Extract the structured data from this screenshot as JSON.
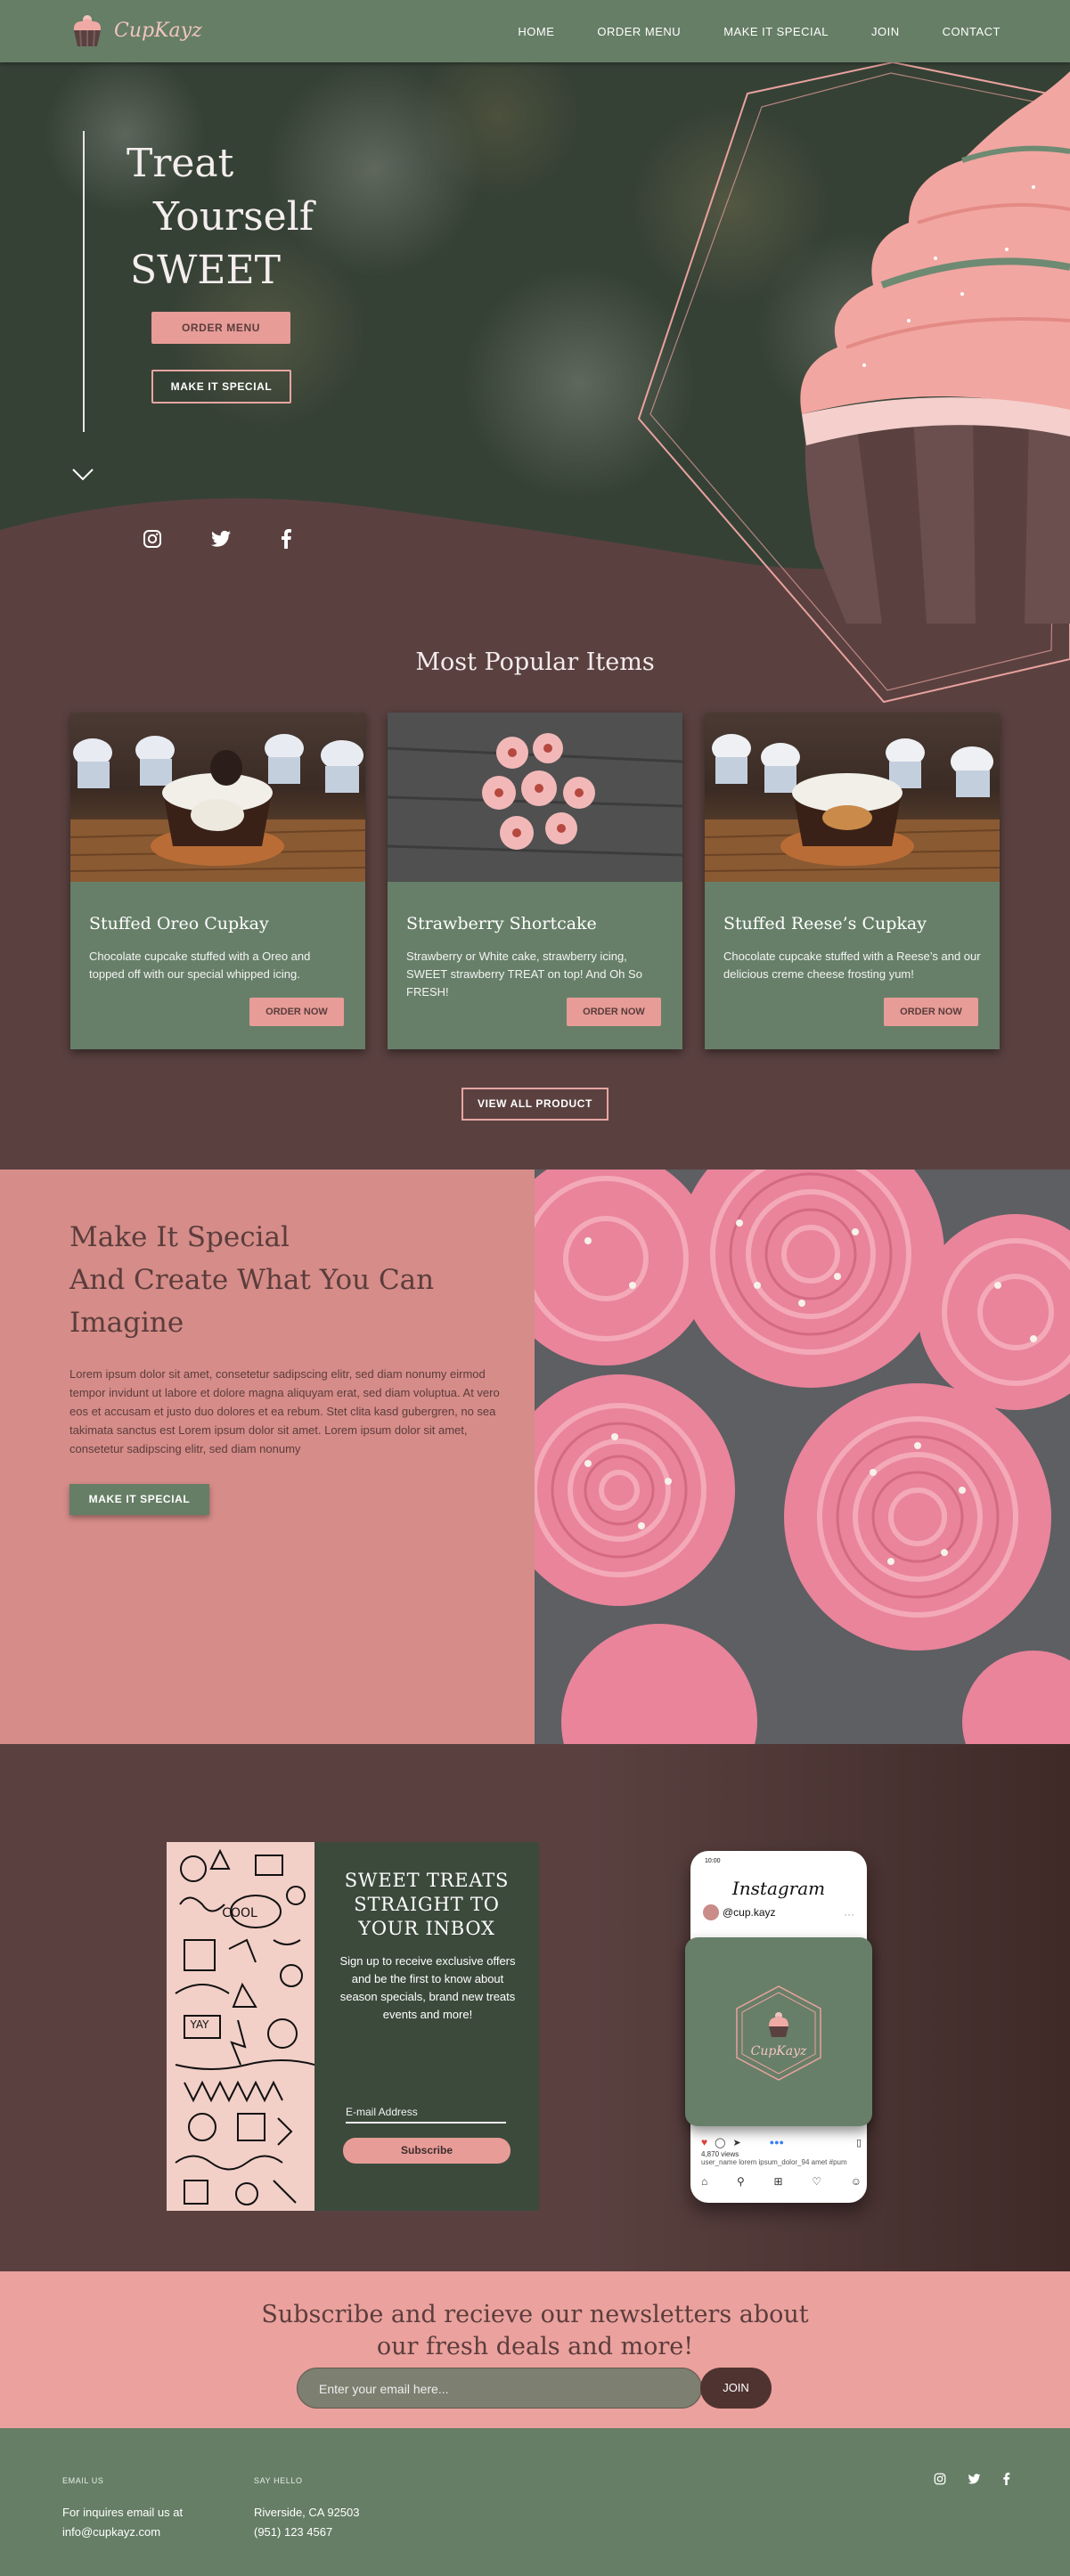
{
  "nav": {
    "logo_text": "CupKayz",
    "links": [
      "HOME",
      "ORDER MENU",
      "MAKE IT SPECIAL",
      "JOIN",
      "CONTACT"
    ]
  },
  "hero": {
    "title_lines": [
      "Treat",
      "Yourself",
      "SWEET"
    ],
    "btn_order": "ORDER MENU",
    "btn_special": "MAKE IT SPECIAL",
    "social_icons": [
      "instagram-icon",
      "twitter-icon",
      "facebook-icon"
    ]
  },
  "popular": {
    "title": "Most Popular Items",
    "items": [
      {
        "title": "Stuffed Oreo Cupkay",
        "desc": "Chocolate cupcake stuffed with a Oreo and topped off with our special whipped icing.",
        "btn": "ORDER NOW"
      },
      {
        "title": "Strawberry Shortcake",
        "desc": "Strawberry or White cake, strawberry icing, SWEET strawberry TREAT on top! And Oh So FRESH!",
        "btn": "ORDER NOW"
      },
      {
        "title": "Stuffed Reese’s Cupkay",
        "desc": "Chocolate cupcake stuffed with a Reese’s and our delicious creme cheese frosting yum!",
        "btn": "ORDER NOW"
      }
    ],
    "view_all": "VIEW ALL PRODUCT"
  },
  "special": {
    "title_lines": [
      "Make It Special",
      "And Create What You Can",
      "Imagine"
    ],
    "text": "Lorem ipsum dolor sit amet, consetetur sadipscing elitr, sed diam nonumy eirmod tempor invidunt ut labore et dolore magna aliquyam erat, sed diam voluptua. At vero eos et accusam et justo duo dolores et ea rebum. Stet clita kasd gubergren, no sea takimata sanctus est Lorem ipsum dolor sit amet. Lorem ipsum dolor sit amet, consetetur sadipscing elitr, sed diam nonumy",
    "btn": "MAKE IT SPECIAL"
  },
  "newsletter_card": {
    "heading_lines": [
      "SWEET TREATS",
      "STRAIGHT TO",
      "YOUR INBOX"
    ],
    "body": "Sign up to receive exclusive offers and be the first to know about season specials, brand new treats events and more!",
    "email_label": "E-mail Address",
    "btn": "Subscribe",
    "doodle_words": [
      "COOL",
      "YAY"
    ]
  },
  "phone": {
    "time": "10:00",
    "app_title": "Instagram",
    "username": "@cup.kayz",
    "post_logo": "CupKayz",
    "views": "4,870 views",
    "caption": "user_name lorem ipsum_dolor_94 amet #pum"
  },
  "subscribe": {
    "title_lines": [
      "Subscribe and recieve our newsletters about",
      "our fresh deals and more!"
    ],
    "placeholder": "Enter your email here...",
    "btn": "JOIN"
  },
  "footer": {
    "email_label": "EMAIL US",
    "email_lines": [
      "For inquires email us at",
      "info@cupkayz.com"
    ],
    "hello_label": "SAY HELLO",
    "hello_lines": [
      "Riverside, CA 92503",
      "(951) 123 4567"
    ],
    "social_icons": [
      "instagram-icon",
      "twitter-icon",
      "facebook-icon"
    ]
  },
  "colors": {
    "sage": "#667e66",
    "brown": "#5a4140",
    "pink": "#e79c97",
    "dark_pink": "#d68c88"
  }
}
